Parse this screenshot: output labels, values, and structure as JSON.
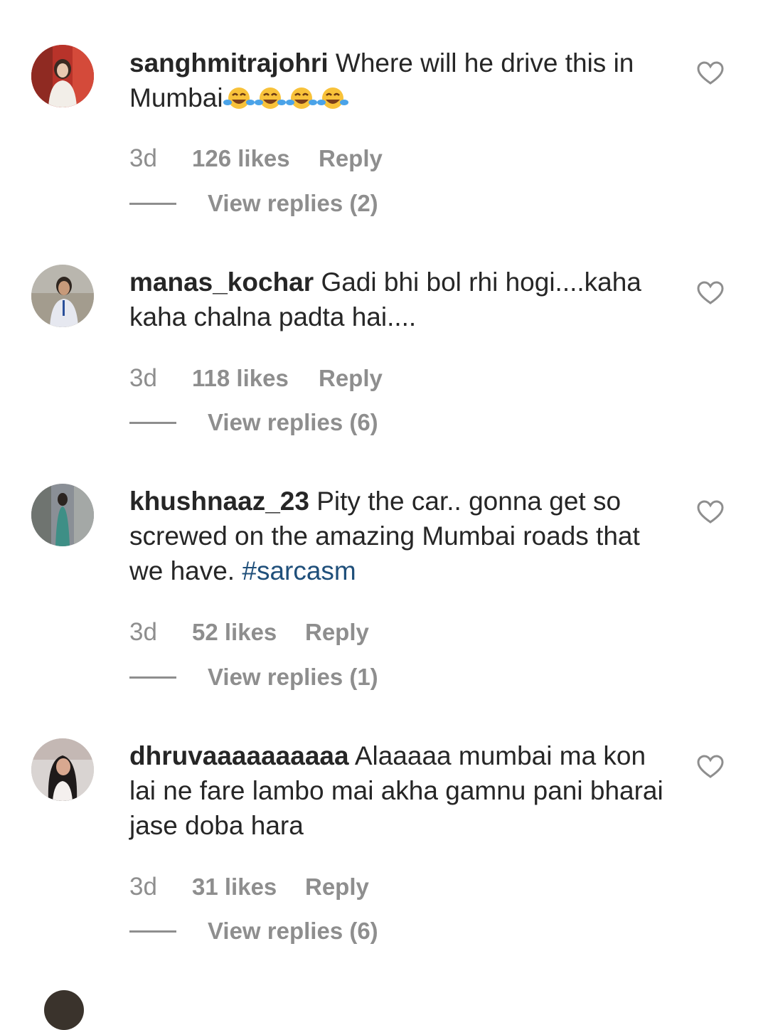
{
  "comments": [
    {
      "username": "sanghmitrajohri",
      "text": "Where will he drive this in Mumbai",
      "emojis": [
        "face-with-tears-of-joy",
        "face-with-tears-of-joy",
        "face-with-tears-of-joy",
        "face-with-tears-of-joy"
      ],
      "time": "3d",
      "likes": "126 likes",
      "reply": "Reply",
      "view_replies": "View replies (2)",
      "avatar_colors": {
        "bg": "#c63a2d",
        "figure": "#f2e9e0"
      }
    },
    {
      "username": "manas_kochar",
      "text": "Gadi bhi bol rhi hogi....kaha kaha chalna padta hai....",
      "time": "3d",
      "likes": "118 likes",
      "reply": "Reply",
      "view_replies": "View replies (6)",
      "avatar_colors": {
        "bg": "#b9b6ae",
        "figure": "#e6e8f0"
      }
    },
    {
      "username": "khushnaaz_23",
      "text": "Pity the car.. gonna get so screwed on the amazing Mumbai roads that we have.",
      "hashtag": "#sarcasm",
      "time": "3d",
      "likes": "52 likes",
      "reply": "Reply",
      "view_replies": "View replies (1)",
      "avatar_colors": {
        "bg": "#8a8f96",
        "figure": "#3e8f86"
      }
    },
    {
      "username": "dhruvaaaaaaaaaa",
      "text": "Alaaaaa mumbai ma kon lai ne fare lambo mai akha gamnu pani bharai jase doba hara",
      "time": "3d",
      "likes": "31 likes",
      "reply": "Reply",
      "view_replies": "View replies (6)",
      "avatar_colors": {
        "bg": "#d9d4d2",
        "figure": "#1e1a1a"
      }
    }
  ],
  "colors": {
    "text": "#262626",
    "meta": "#8e8e8e",
    "hashtag": "#1f4f7a",
    "background": "#ffffff"
  },
  "icons": {
    "like": "heart-outline-icon",
    "emoji": "face-with-tears-of-joy"
  }
}
